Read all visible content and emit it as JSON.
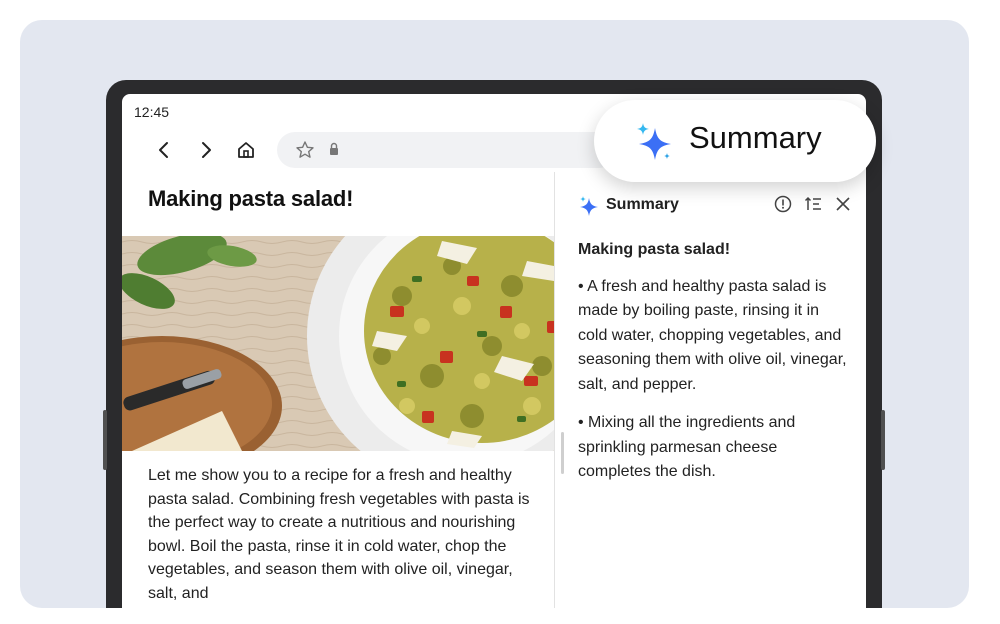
{
  "status": {
    "time": "12:45"
  },
  "browser": {
    "back_icon": "chevron-left-icon",
    "forward_icon": "chevron-right-icon",
    "home_icon": "home-icon",
    "bookmark_icon": "star-icon",
    "lock_icon": "lock-icon"
  },
  "article": {
    "title": "Making pasta salad!",
    "body": "Let me show you to a recipe for a fresh and healthy pasta salad. Combining fresh vegetables with pasta is the perfect way to create a nutritious and nourishing bowl. Boil the pasta, rinse it in cold water, chop the vegetables, and season them with olive oil, vinegar, salt, and"
  },
  "summary_panel": {
    "title": "Summary",
    "heading": "Making pasta salad!",
    "points": [
      "• A fresh and healthy pasta salad is made by boiling paste, rinsing it in cold water, chopping vegetables, and seasoning them with olive oil, vinegar, salt, and pepper.",
      "• Mixing all the ingredients and sprinkling parmesan cheese completes the dish."
    ],
    "icons": [
      "info-icon",
      "sort-icon",
      "close-icon"
    ]
  },
  "floating_pill": {
    "label": "Summary"
  },
  "colors": {
    "sparkle_blue": "#3b6ff5",
    "sparkle_cyan": "#35b8f0",
    "stage_bg": "#e3e7f0"
  }
}
